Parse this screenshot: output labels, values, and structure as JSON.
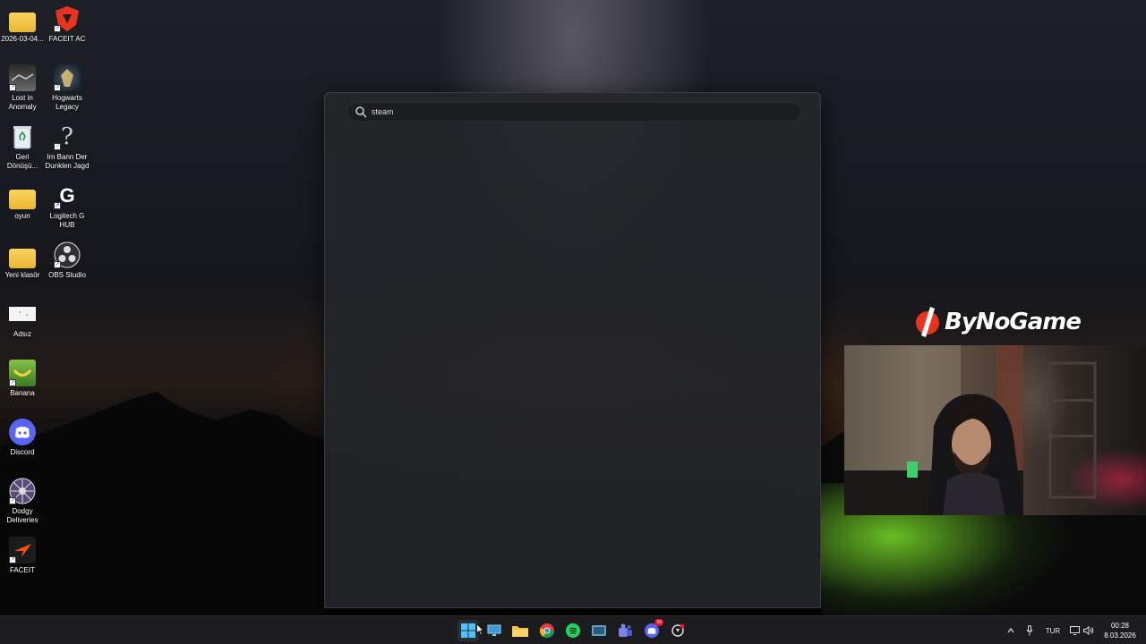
{
  "desktop": {
    "icons": [
      {
        "label": "2026-03-04...",
        "icon": "folder-icon"
      },
      {
        "label": "FACEIT AC",
        "icon": "faceit-ac-icon"
      },
      {
        "label": "Lost in Anomaly",
        "icon": "lost-in-anomaly-icon"
      },
      {
        "label": "Hogwarts Legacy",
        "icon": "hogwarts-legacy-icon"
      },
      {
        "label": "Geri Dönüşü...",
        "icon": "recycle-bin-icon"
      },
      {
        "label": "Im Bann Der Dunklen Jagd",
        "icon": "im-bann-icon"
      },
      {
        "label": "oyun",
        "icon": "folder-icon"
      },
      {
        "label": "Logitech G HUB",
        "icon": "logitech-g-hub-icon"
      },
      {
        "label": "Yeni klasör",
        "icon": "folder-icon"
      },
      {
        "label": "OBS Studio",
        "icon": "obs-studio-icon"
      },
      {
        "label": "Adsız",
        "icon": "image-file-icon"
      },
      {
        "label": "Banana",
        "icon": "banana-icon"
      },
      {
        "label": "Discord",
        "icon": "discord-icon"
      },
      {
        "label": "Dodgy Deliveries",
        "icon": "dodgy-deliveries-icon"
      },
      {
        "label": "FACEIT",
        "icon": "faceit-icon"
      }
    ]
  },
  "start_panel": {
    "search": {
      "value": "steam",
      "icon": "search-icon"
    }
  },
  "overlay": {
    "brand_text": "ByNoGame",
    "brand_color": "#e8341c"
  },
  "taskbar": {
    "apps": [
      {
        "name": "start",
        "icon": "windows-start-icon",
        "active": true
      },
      {
        "name": "desktop",
        "icon": "desktop-icon"
      },
      {
        "name": "file-explorer",
        "icon": "file-explorer-icon"
      },
      {
        "name": "chrome",
        "icon": "chrome-icon"
      },
      {
        "name": "spotify",
        "icon": "spotify-icon"
      },
      {
        "name": "task-view",
        "icon": "task-view-icon"
      },
      {
        "name": "teams",
        "icon": "teams-icon"
      },
      {
        "name": "discord",
        "icon": "discord-icon",
        "badge": "99"
      },
      {
        "name": "faceit-ac",
        "icon": "faceit-ac-tray-icon"
      }
    ],
    "tray": {
      "language": "TUR",
      "time": "00:28",
      "date": "8.03.2026"
    }
  }
}
